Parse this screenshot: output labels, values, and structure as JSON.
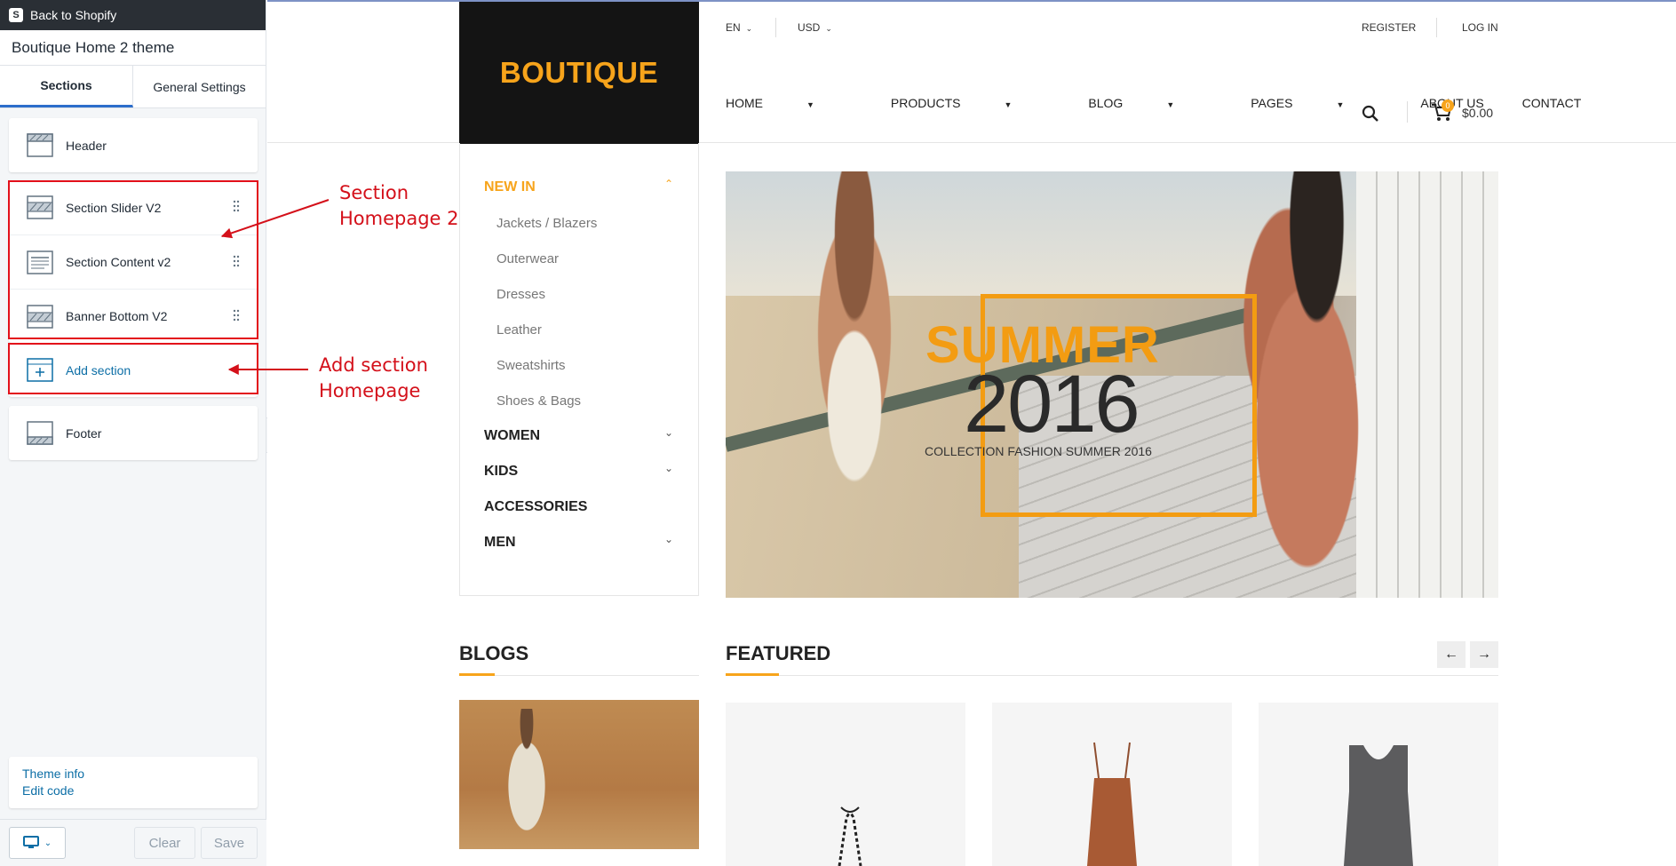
{
  "sidebar": {
    "back_label": "Back to Shopify",
    "theme_name": "Boutique Home 2 theme",
    "tabs": [
      "Sections",
      "General Settings"
    ],
    "header_section": "Header",
    "sections": [
      "Section Slider V2",
      "Section Content v2",
      "Banner Bottom V2"
    ],
    "add_section": "Add section",
    "footer_section": "Footer",
    "theme_info": "Theme info",
    "edit_code": "Edit code",
    "clear_label": "Clear",
    "save_label": "Save"
  },
  "annotations": {
    "section_homepage": [
      "Section",
      "Homepage 2"
    ],
    "add_section_homepage": [
      "Add section",
      "Homepage"
    ],
    "color": "#d4101a"
  },
  "store": {
    "logo": "BOUTIQUE",
    "lang": "EN",
    "currency": "USD",
    "register": "REGISTER",
    "login": "LOG IN",
    "nav": [
      "HOME",
      "PRODUCTS",
      "BLOG",
      "PAGES",
      "ABOUT US",
      "CONTACT"
    ],
    "cart_count": "0",
    "cart_total": "$0.00",
    "categories": {
      "new_in": "NEW IN",
      "new_in_items": [
        "Jackets / Blazers",
        "Outerwear",
        "Dresses",
        "Leather",
        "Sweatshirts",
        "Shoes & Bags"
      ],
      "others": [
        "WOMEN",
        "KIDS",
        "ACCESSORIES",
        "MEN"
      ]
    },
    "hero": {
      "headline": "SUMMER",
      "year": "2016",
      "caption": "COLLECTION FASHION SUMMER 2016"
    },
    "blogs_title": "BLOGS",
    "featured_title": "FEATURED",
    "accent_color": "#f7a41b"
  }
}
